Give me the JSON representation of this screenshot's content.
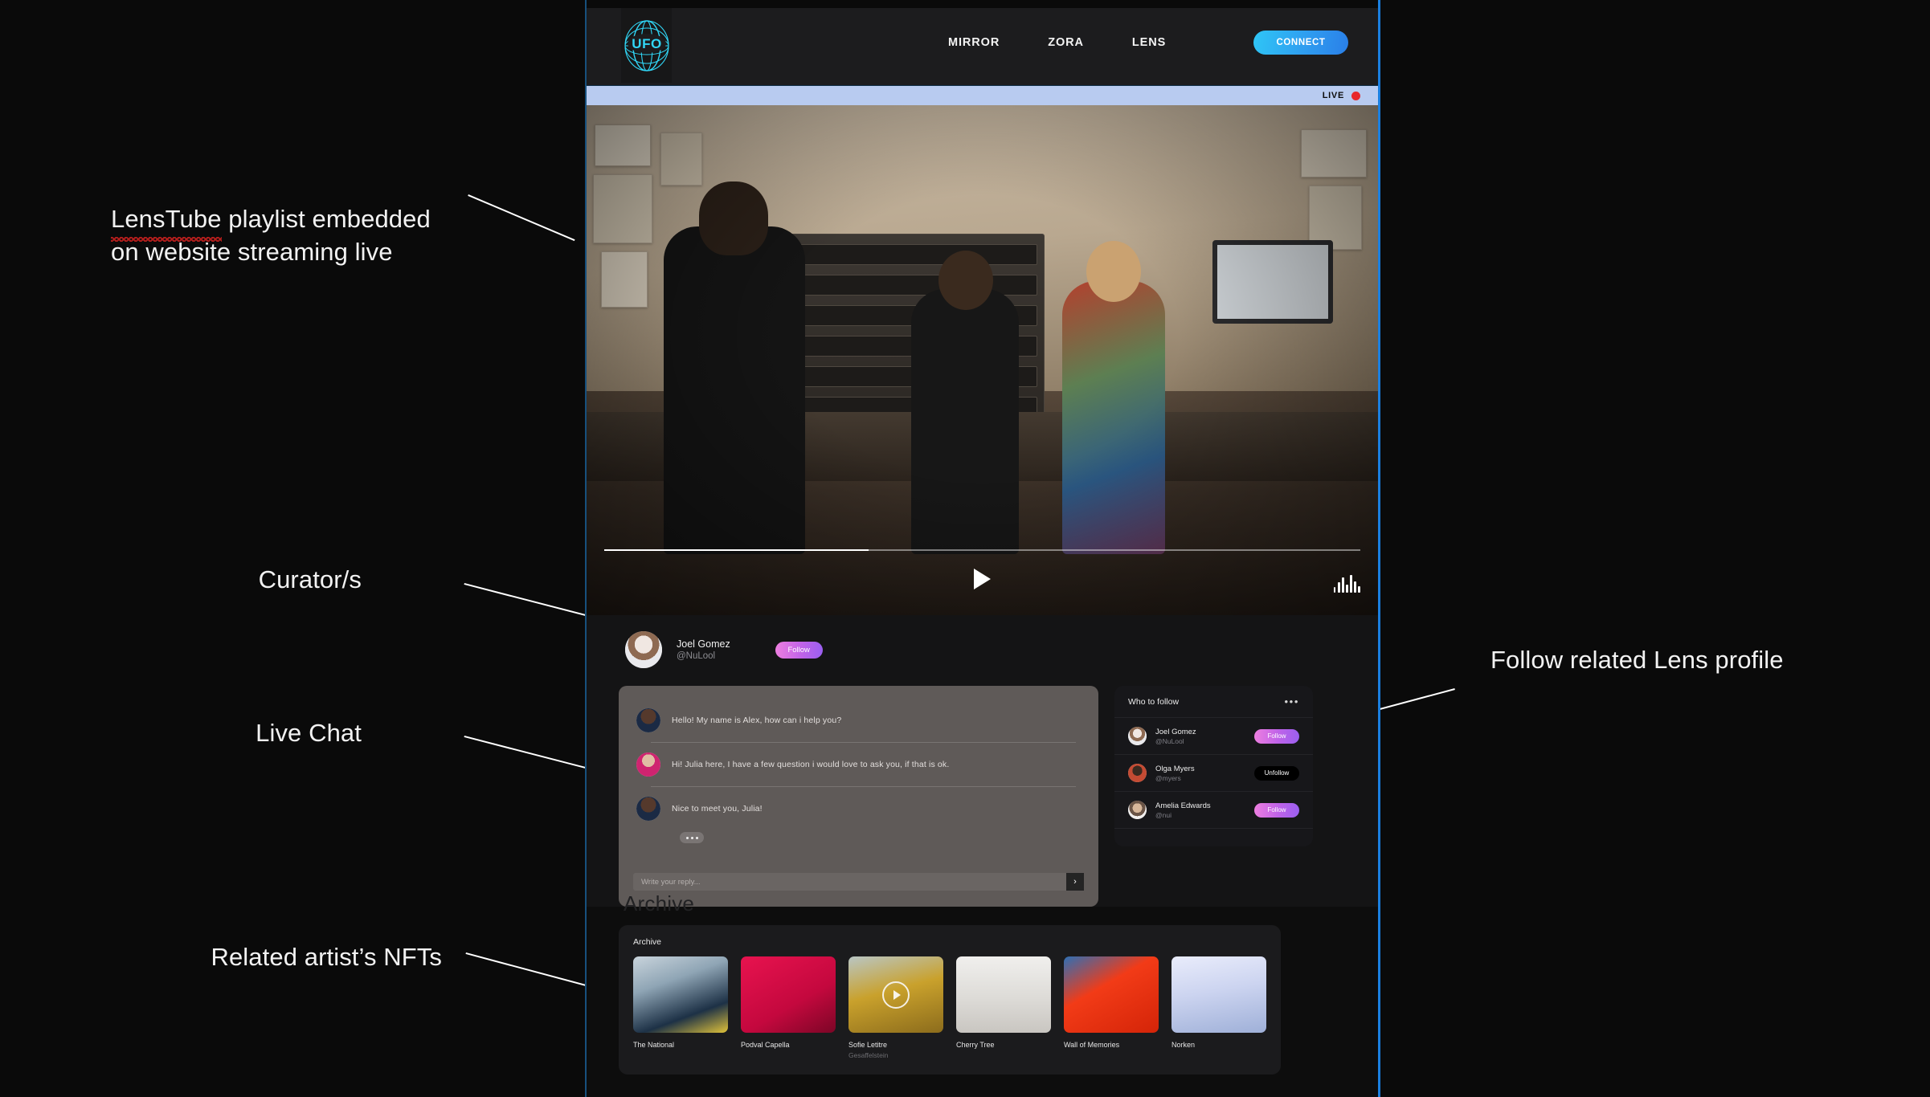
{
  "annotations": [
    {
      "id": "a1",
      "text": "LensTube playlist embedded\non website streaming live",
      "misspelled": "LensTube"
    },
    {
      "id": "a2",
      "text": "Curator/s"
    },
    {
      "id": "a3",
      "text": "Live Chat"
    },
    {
      "id": "a4",
      "text": "Follow related Lens profile"
    },
    {
      "id": "a5",
      "text": "Related artist’s NFTs"
    }
  ],
  "site": {
    "header": {
      "logo_text": "UFO",
      "nav": [
        {
          "label": "MIRROR"
        },
        {
          "label": "ZORA"
        },
        {
          "label": "LENS"
        }
      ],
      "connect_label": "CONNECT"
    },
    "player": {
      "live_label": "LIVE",
      "progress_percent": 35,
      "play_icon": "play-icon",
      "equalizer_icon": "equalizer-icon"
    },
    "curator": {
      "name": "Joel Gomez",
      "handle": "@NuLool",
      "follow_label": "Follow",
      "avatar": "avatar-joel"
    },
    "chat": {
      "messages": [
        {
          "avatar": "avatar-alex",
          "text": "Hello! My name is Alex, how can i help you?"
        },
        {
          "avatar": "avatar-julia",
          "text": "Hi! Julia here, I have a few question i would love to ask you, if that is ok."
        },
        {
          "avatar": "avatar-alex",
          "text": "Nice to meet you, Julia!"
        }
      ],
      "typing_indicator": true,
      "input_value": "",
      "input_placeholder": "Write your reply...",
      "send_icon": "›"
    },
    "who_to_follow": {
      "title": "Who to follow",
      "menu_icon": "•••",
      "people": [
        {
          "name": "Joel Gomez",
          "handle": "@NuLool",
          "action": "Follow",
          "state": "follow",
          "avatar": "avatar-joel"
        },
        {
          "name": "Olga Myers",
          "handle": "@myers",
          "action": "Unfollow",
          "state": "unfollow",
          "avatar": "avatar-olga"
        },
        {
          "name": "Amelia Edwards",
          "handle": "@nui",
          "action": "Follow",
          "state": "follow",
          "avatar": "avatar-amelia"
        }
      ]
    },
    "ghost_heading": "Archive",
    "archive": {
      "title": "Archive",
      "items": [
        {
          "label": "The National",
          "sub": "",
          "thumb": "t1",
          "has_play": false
        },
        {
          "label": "Podval Capella",
          "sub": "",
          "thumb": "t2",
          "has_play": false
        },
        {
          "label": "Sofie Letitre",
          "sub": "Gesaffelstein",
          "thumb": "t3",
          "has_play": true
        },
        {
          "label": "Cherry Tree",
          "sub": "",
          "thumb": "t4",
          "has_play": false
        },
        {
          "label": "Wall of Memories",
          "sub": "",
          "thumb": "t5",
          "has_play": false
        },
        {
          "label": "Norken",
          "sub": "",
          "thumb": "t6",
          "has_play": false
        }
      ]
    }
  },
  "colors": {
    "page_bg": "#0a0a0a",
    "site_bg": "#141415",
    "accent_blue": "#2f9df0",
    "border_blue": "#1a7fe0",
    "live_bar": "#b8cbf0",
    "live_dot": "#e8262b",
    "follow_pink": "#ee7fe0",
    "follow_purple": "#9a5ff0",
    "chat_panel": "#5f5a58",
    "card_bg": "#17171a"
  }
}
